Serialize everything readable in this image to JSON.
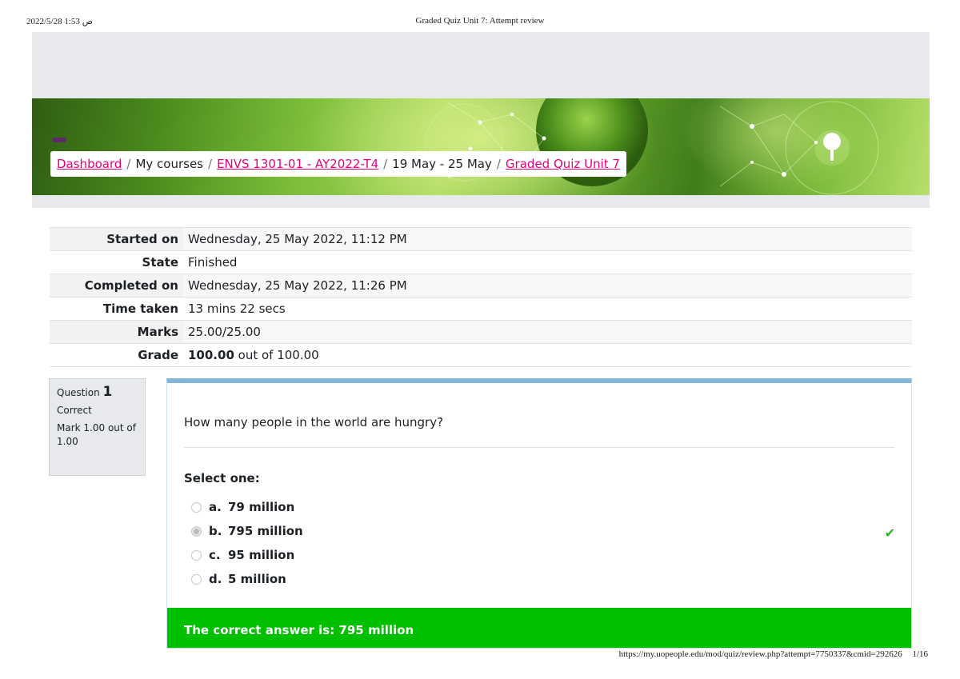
{
  "print_header": {
    "date": "ﺹ 1:53 2022/5/28",
    "title": "Graded Quiz Unit 7: Attempt review"
  },
  "breadcrumb": [
    {
      "label": "Dashboard",
      "link": true
    },
    {
      "label": "My courses",
      "link": false
    },
    {
      "label": "ENVS 1301-01 - AY2022-T4",
      "link": true
    },
    {
      "label": "19 May - 25 May",
      "link": false
    },
    {
      "label": "Graded Quiz Unit 7",
      "link": true
    }
  ],
  "breadcrumb_separator": "/",
  "summary": [
    {
      "label": "Started on",
      "value": "Wednesday, 25 May 2022, 11:12 PM"
    },
    {
      "label": "State",
      "value": "Finished"
    },
    {
      "label": "Completed on",
      "value": "Wednesday, 25 May 2022, 11:26 PM"
    },
    {
      "label": "Time taken",
      "value": "13 mins 22 secs"
    },
    {
      "label": "Marks",
      "value": "25.00/25.00"
    },
    {
      "label": "Grade",
      "value_bold": "100.00",
      "value_rest": " out of 100.00"
    }
  ],
  "question": {
    "label": "Question",
    "number": "1",
    "state": "Correct",
    "mark": "Mark 1.00 out of 1.00",
    "text": "How many people in the world are hungry?",
    "prompt": "Select one:",
    "options": [
      {
        "letter": "a.",
        "text": "79 million",
        "selected": false
      },
      {
        "letter": "b.",
        "text": "795 million",
        "selected": true
      },
      {
        "letter": "c.",
        "text": "95 million",
        "selected": false
      },
      {
        "letter": "d.",
        "text": "5 million",
        "selected": false
      }
    ],
    "correct_icon": "check-icon",
    "feedback": "The correct answer is: 795 million"
  },
  "print_footer": {
    "url": "https://my.uopeople.edu/mod/quiz/review.php?attempt=7750337&cmid=292626",
    "page": "1/16"
  },
  "colors": {
    "link": "#e6007e",
    "feedback_bg": "#00c000",
    "question_border": "#86b6da",
    "check": "#29b029"
  }
}
